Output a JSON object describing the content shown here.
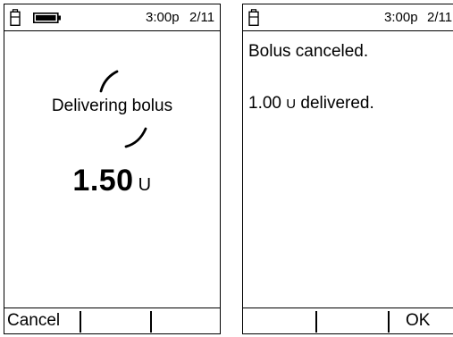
{
  "left_screen": {
    "status": {
      "time": "3:00p",
      "date": "2/11",
      "cartridge_icon": "cartridge-icon",
      "battery_icon": "battery-icon"
    },
    "message": "Delivering bolus",
    "dose_value": "1.50",
    "dose_unit": "U",
    "softkeys": {
      "left": "Cancel",
      "middle": "",
      "right": ""
    }
  },
  "right_screen": {
    "status": {
      "time": "3:00p",
      "date": "2/11",
      "cartridge_icon": "cartridge-icon"
    },
    "line1": "Bolus canceled.",
    "line2_value": "1.00",
    "line2_unit": "U",
    "line2_rest": "delivered.",
    "softkeys": {
      "left": "",
      "middle": "",
      "right": "OK"
    }
  }
}
